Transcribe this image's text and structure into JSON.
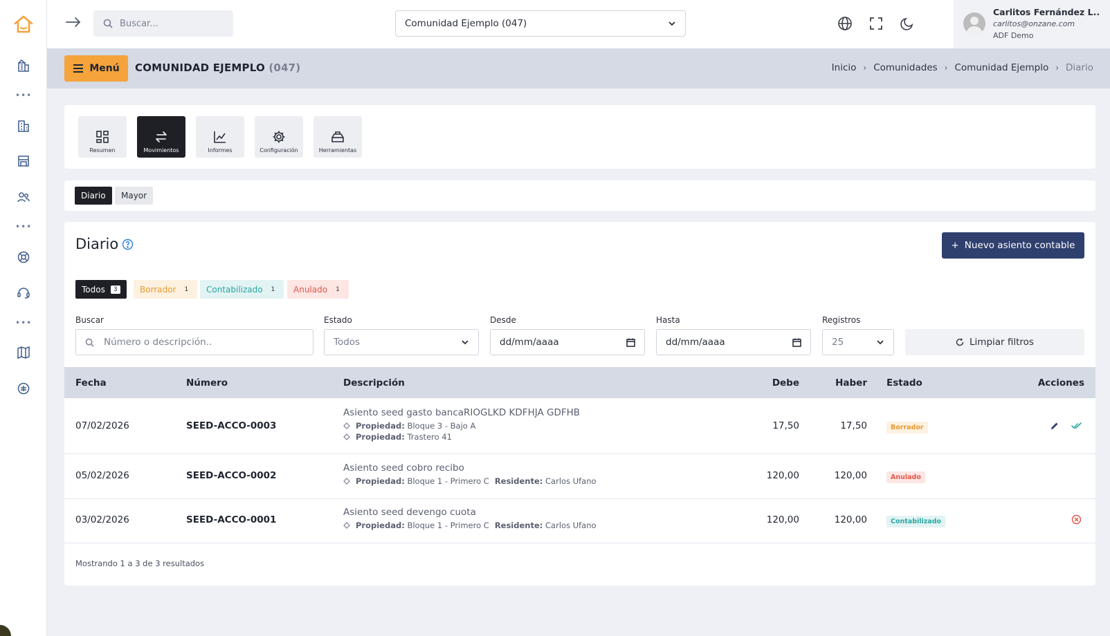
{
  "topbar": {
    "search_placeholder": "Buscar...",
    "community_selected": "Comunidad Ejemplo (047)",
    "user": {
      "name": "Carlitos Fernández L..",
      "email": "carlitos@onzane.com",
      "org": "ADF Demo"
    }
  },
  "header": {
    "menu_label": "Menú",
    "title": "COMUNIDAD EJEMPLO",
    "title_code": "(047)",
    "breadcrumb": [
      "Inicio",
      "Comunidades",
      "Comunidad Ejemplo",
      "Diario"
    ]
  },
  "modules": [
    {
      "label": "Resumen",
      "icon": "grid-icon"
    },
    {
      "label": "Movimientos",
      "icon": "transfer-arrows-icon",
      "active": true
    },
    {
      "label": "Informes",
      "icon": "line-chart-icon"
    },
    {
      "label": "Configuración",
      "icon": "gear-icon"
    },
    {
      "label": "Herramientas",
      "icon": "toolbox-icon"
    }
  ],
  "subtabs": [
    {
      "label": "Diario",
      "active": true
    },
    {
      "label": "Mayor"
    }
  ],
  "main": {
    "title": "Diario",
    "new_button": "Nuevo asiento contable",
    "new_button_icon": "+",
    "status_pills": [
      {
        "label": "Todos",
        "count": "3"
      },
      {
        "label": "Borrador",
        "count": "1"
      },
      {
        "label": "Contabilizado",
        "count": "1"
      },
      {
        "label": "Anulado",
        "count": "1"
      }
    ],
    "filters": {
      "buscar_label": "Buscar",
      "buscar_placeholder": "Número o descripción..",
      "estado_label": "Estado",
      "estado_value": "Todos",
      "desde_label": "Desde",
      "desde_value": "dd/mm/aaaa",
      "hasta_label": "Hasta",
      "hasta_value": "dd/mm/aaaa",
      "registros_label": "Registros",
      "registros_value": "25",
      "clear_label": "Limpiar filtros"
    },
    "table": {
      "headers": [
        "Fecha",
        "Número",
        "Descripción",
        "Debe",
        "Haber",
        "Estado",
        "Acciones"
      ],
      "rows": [
        {
          "fecha": "07/02/2026",
          "numero": "SEED-ACCO-0003",
          "descripcion": "Asiento seed gasto bancaRIOGLKD KDFHJA GDFHB",
          "meta1_label": "Propiedad:",
          "meta1_value": "Bloque 3 - Bajo A",
          "meta2_label": "Propiedad:",
          "meta2_value": "Trastero 41",
          "debe": "17,50",
          "haber": "17,50",
          "estado": "Borrador"
        },
        {
          "fecha": "05/02/2026",
          "numero": "SEED-ACCO-0002",
          "descripcion": "Asiento seed cobro recibo",
          "meta1_label": "Propiedad:",
          "meta1_value": "Bloque 1 - Primero C",
          "meta2_label": "Residente:",
          "meta2_value": "Carlos Ufano",
          "debe": "120,00",
          "haber": "120,00",
          "estado": "Anulado"
        },
        {
          "fecha": "03/02/2026",
          "numero": "SEED-ACCO-0001",
          "descripcion": "Asiento seed devengo cuota",
          "meta1_label": "Propiedad:",
          "meta1_value": "Bloque 1 - Primero C",
          "meta2_label": "Residente:",
          "meta2_value": "Carlos Ufano",
          "debe": "120,00",
          "haber": "120,00",
          "estado": "Contabilizado"
        }
      ]
    },
    "footer": "Mostrando 1 a 3 de 3 resultados"
  },
  "colors": {
    "accent_orange": "#f5a33b",
    "primary_navy": "#2f3f6e",
    "dark": "#1e2026"
  }
}
